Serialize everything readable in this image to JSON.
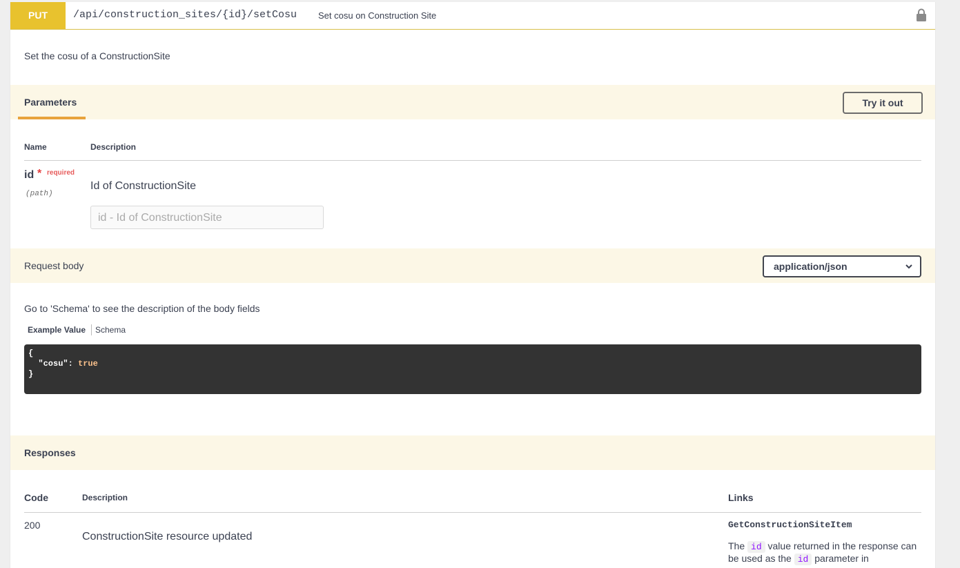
{
  "operation": {
    "method": "PUT",
    "path": "/api/construction_sites/{id}/setCosu",
    "summary": "Set cosu on Construction Site",
    "description": "Set the cosu of a ConstructionSite",
    "lock_icon": "lock-icon"
  },
  "parameters": {
    "tab_label": "Parameters",
    "try_button": "Try it out",
    "col_name": "Name",
    "col_description": "Description",
    "items": [
      {
        "name": "id",
        "required_star": "*",
        "required_label": "required",
        "in": "(path)",
        "description": "Id of ConstructionSite",
        "placeholder": "id - Id of ConstructionSite"
      }
    ]
  },
  "request_body": {
    "label": "Request body",
    "content_type": "application/json",
    "schema_note": "Go to 'Schema' to see the description of the body fields",
    "tab_example": "Example Value",
    "tab_schema": "Schema",
    "code_lines": {
      "open": "{",
      "key": "  \"cosu\": ",
      "value": "true",
      "close": "}"
    }
  },
  "responses": {
    "title": "Responses",
    "col_code": "Code",
    "col_description": "Description",
    "col_links": "Links",
    "items": [
      {
        "code": "200",
        "description": "ConstructionSite resource updated",
        "link_name": "GetConstructionSiteItem",
        "link_text_1": "The ",
        "link_code_1": "id",
        "link_text_2": " value returned in the response can be used as the ",
        "link_code_2": "id",
        "link_text_3": " parameter in"
      }
    ]
  },
  "colors": {
    "put": "#e8c22e",
    "band": "#fcf7e6",
    "accent": "#e8a33c",
    "code_bg": "#333333"
  }
}
